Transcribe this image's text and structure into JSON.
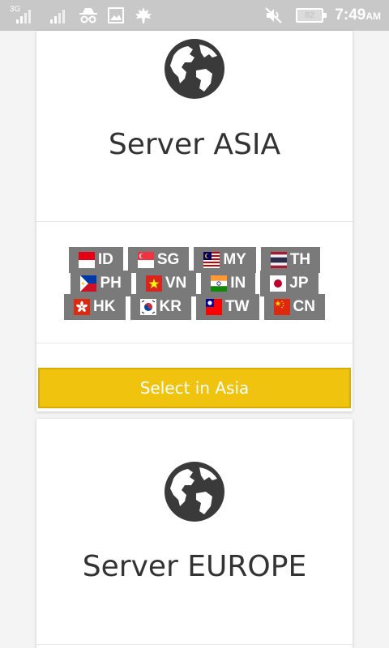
{
  "statusbar": {
    "sim1_label": "3G",
    "battery_level": "82",
    "time": "7:49",
    "ampm": "AM",
    "icons": [
      "signal-icon",
      "signal-icon",
      "incognito-icon",
      "image-icon",
      "maple-leaf-icon",
      "mute-icon",
      "battery-icon"
    ]
  },
  "asia": {
    "title": "Server ASIA",
    "button_label": "Select in Asia",
    "countries": [
      [
        {
          "code": "ID",
          "flag": "indonesia"
        },
        {
          "code": "SG",
          "flag": "singapore"
        },
        {
          "code": "MY",
          "flag": "malaysia"
        },
        {
          "code": "TH",
          "flag": "thailand"
        }
      ],
      [
        {
          "code": "PH",
          "flag": "philippines"
        },
        {
          "code": "VN",
          "flag": "vietnam"
        },
        {
          "code": "IN",
          "flag": "india"
        },
        {
          "code": "JP",
          "flag": "japan"
        }
      ],
      [
        {
          "code": "HK",
          "flag": "hongkong"
        },
        {
          "code": "KR",
          "flag": "korea"
        },
        {
          "code": "TW",
          "flag": "taiwan"
        },
        {
          "code": "CN",
          "flag": "china"
        }
      ]
    ]
  },
  "europe": {
    "title": "Server EUROPE"
  },
  "colors": {
    "accent_button": "#f0c30f",
    "chip_background": "#7a7a7a",
    "statusbar": "#c8c8c8"
  }
}
